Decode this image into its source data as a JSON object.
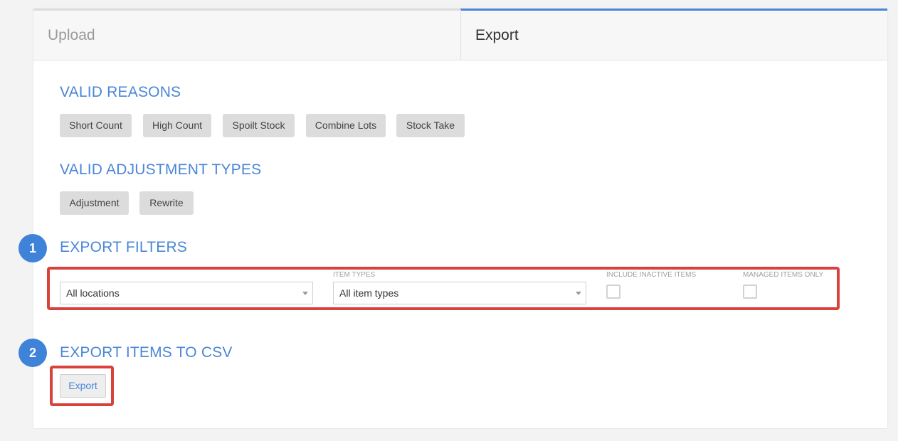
{
  "tabs": [
    {
      "label": "Upload",
      "active": false
    },
    {
      "label": "Export",
      "active": true
    }
  ],
  "valid_reasons": {
    "title": "VALID REASONS",
    "items": [
      "Short Count",
      "High Count",
      "Spoilt Stock",
      "Combine Lots",
      "Stock Take"
    ]
  },
  "valid_adjustment_types": {
    "title": "VALID ADJUSTMENT TYPES",
    "items": [
      "Adjustment",
      "Rewrite"
    ]
  },
  "export_filters": {
    "step": "1",
    "title": "EXPORT FILTERS",
    "location_select": {
      "value": "All locations"
    },
    "item_types": {
      "label": "ITEM TYPES",
      "value": "All item types"
    },
    "include_inactive": {
      "label": "INCLUDE INACTIVE ITEMS",
      "checked": false
    },
    "managed_only": {
      "label": "MANAGED ITEMS ONLY",
      "checked": false
    }
  },
  "export_csv": {
    "step": "2",
    "title": "EXPORT ITEMS TO CSV",
    "button_label": "Export"
  },
  "colors": {
    "accent": "#4a86d6",
    "step_badge": "#3e83d8",
    "highlight": "#d9423c",
    "chip_bg": "#dcdcdc"
  }
}
